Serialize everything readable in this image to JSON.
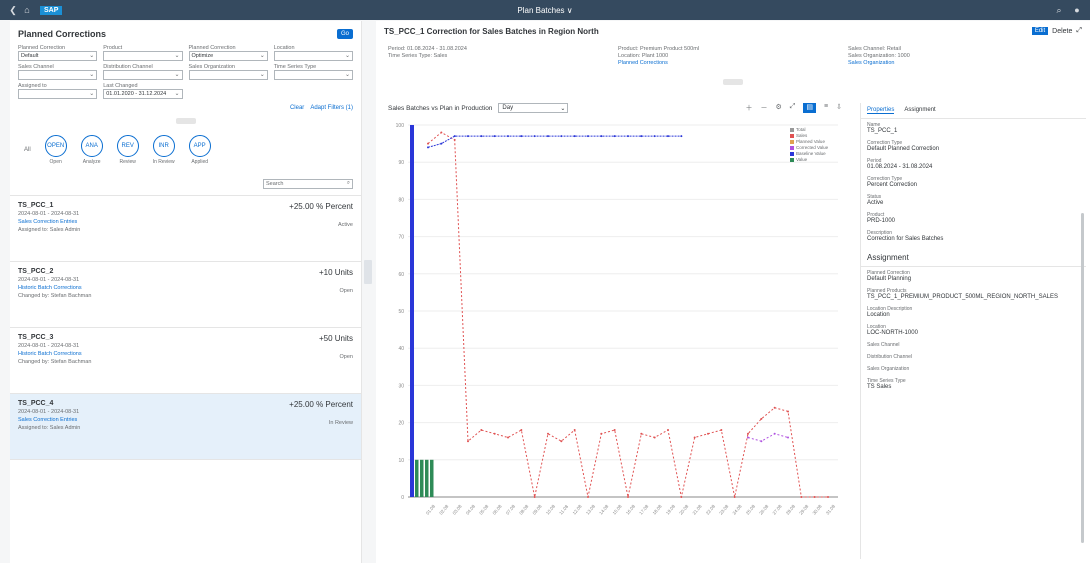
{
  "shell": {
    "title": "Plan Batches ∨",
    "logo": "SAP"
  },
  "left": {
    "title": "Planned Corrections",
    "go_label": "Go",
    "filters": [
      {
        "label": "Planned Correction",
        "value": "Default"
      },
      {
        "label": "Product",
        "value": ""
      },
      {
        "label": "Planned Correction",
        "value": "Optimize"
      },
      {
        "label": "Location",
        "value": ""
      },
      {
        "label": "Sales Channel",
        "value": ""
      },
      {
        "label": "Distribution Channel",
        "value": ""
      },
      {
        "label": "Sales Organization",
        "value": ""
      },
      {
        "label": "Time Series Type",
        "value": ""
      },
      {
        "label": "Assigned to",
        "value": ""
      },
      {
        "label": "Last Changed",
        "value": "01.01.2020 - 31.12.2024"
      }
    ],
    "clear_label": "Clear",
    "adapt_label": "Adapt Filters (1)",
    "tiles": [
      {
        "label": "Open",
        "value": "OPEN"
      },
      {
        "label": "Analyze",
        "value": "ANA"
      },
      {
        "label": "Review",
        "value": "REV"
      },
      {
        "label": "In Review",
        "value": "INR"
      },
      {
        "label": "Applied",
        "value": "APP"
      }
    ],
    "tiles_prefix": "All",
    "search_placeholder": "Search",
    "items": [
      {
        "title": "TS_PCC_1",
        "value": "+25.00 % Percent",
        "l1": "2024-08-01 - 2024-08-31",
        "l2": "Sales Correction Entries",
        "l3": "Assigned to: Sales Admin",
        "status": "Active"
      },
      {
        "title": "TS_PCC_2",
        "value": "+10 Units",
        "l1": "2024-08-01 - 2024-08-31",
        "l2": "Historic Batch Corrections",
        "l3": "Changed by: Stefan Bachman",
        "status": "Open"
      },
      {
        "title": "TS_PCC_3",
        "value": "+50 Units",
        "l1": "2024-08-01 - 2024-08-31",
        "l2": "Historic Batch Corrections",
        "l3": "Changed by: Stefan Bachman",
        "status": "Open"
      },
      {
        "title": "TS_PCC_4",
        "value": "+25.00 % Percent",
        "l1": "2024-08-01 - 2024-08-31",
        "l2": "Sales Correction Entries",
        "l3": "Assigned to: Sales Admin",
        "status": "In Review"
      }
    ]
  },
  "main": {
    "title": "TS_PCC_1 Correction for Sales Batches in Region North",
    "edit_label": "Edit",
    "delete_label": "Delete",
    "col1": [
      "Period: 01.08.2024 - 31.08.2024",
      "Time Series Type: Sales"
    ],
    "col2": [
      "Product: Premium Product 500ml",
      "Location: Plant 1000",
      "Planned Corrections"
    ],
    "col3": [
      "Sales Channel: Retail",
      "Sales Organization: 1000",
      "Sales Organization"
    ],
    "chart_title": "Sales Batches vs Plan in Production",
    "chart_select": "Day",
    "legend": [
      "Total",
      "Sales",
      "Planned Value",
      "Corrected Value",
      "Baseline Value",
      "Value"
    ],
    "tabs": [
      "Properties",
      "Assignment"
    ],
    "props": [
      {
        "k": "Name",
        "v": "TS_PCC_1"
      },
      {
        "k": "Correction Type",
        "v": "Default Planned Correction"
      },
      {
        "k": "Period",
        "v": "01.08.2024 - 31.08.2024"
      },
      {
        "k": "Correction Type",
        "v": "Percent Correction"
      },
      {
        "k": "Status",
        "v": "Active"
      },
      {
        "k": "Product",
        "v": "PRD-1000"
      },
      {
        "k": "Description",
        "v": "Correction for Sales Batches"
      }
    ],
    "assignment_title": "Assignment",
    "assign": [
      {
        "k": "Planned Correction",
        "v": "Default Planning"
      },
      {
        "k": "Planned Products",
        "v": "TS_PCC_1_PREMIUM_PRODUCT_500ML_REGION_NORTH_SALES"
      },
      {
        "k": "Location Description",
        "v": "Location"
      },
      {
        "k": "Location",
        "v": "LOC-NORTH-1000"
      },
      {
        "k": "Sales Channel",
        "v": ""
      },
      {
        "k": "Distribution Channel",
        "v": ""
      },
      {
        "k": "Sales Organization",
        "v": ""
      },
      {
        "k": "Time Series Type",
        "v": "TS Sales"
      }
    ]
  },
  "chart_data": {
    "type": "line",
    "x": [
      "01.08",
      "02.08",
      "03.08",
      "04.08",
      "05.08",
      "06.08",
      "07.08",
      "08.08",
      "09.08",
      "10.08",
      "11.08",
      "12.08",
      "13.08",
      "14.08",
      "15.08",
      "16.08",
      "17.08",
      "18.08",
      "19.08",
      "20.08",
      "21.08",
      "22.08",
      "23.08",
      "24.08",
      "25.08",
      "26.08",
      "27.08",
      "28.08",
      "29.08",
      "30.08",
      "31.08"
    ],
    "ylim": [
      0,
      100
    ],
    "yticks": [
      "0",
      "10",
      "20",
      "30",
      "40",
      "50",
      "60",
      "70",
      "80",
      "90",
      "100"
    ],
    "series": [
      {
        "values": [
          95,
          98,
          96,
          15,
          18,
          17,
          16,
          18,
          0,
          17,
          15,
          18,
          0,
          17,
          18,
          0,
          17,
          16,
          18,
          0,
          16,
          17,
          18,
          0,
          17,
          21,
          24,
          23,
          0,
          0,
          0
        ]
      },
      {
        "values": [
          0,
          0,
          0,
          0,
          0,
          0,
          0,
          0,
          0,
          0,
          0,
          0,
          0,
          0,
          0,
          0,
          0,
          0,
          0,
          0,
          0,
          0,
          0,
          0,
          16,
          15,
          17,
          16,
          0,
          0,
          0
        ]
      },
      {
        "values": [
          94,
          95,
          97,
          97,
          97,
          97,
          97,
          97,
          97,
          97,
          97,
          97,
          97,
          97,
          97,
          97,
          97,
          97,
          97,
          97,
          0,
          0,
          0,
          0,
          0,
          0,
          0,
          0,
          0,
          0,
          0
        ]
      }
    ],
    "bars_blue": [
      100
    ],
    "bars_green": [
      10,
      10,
      10,
      10
    ]
  }
}
